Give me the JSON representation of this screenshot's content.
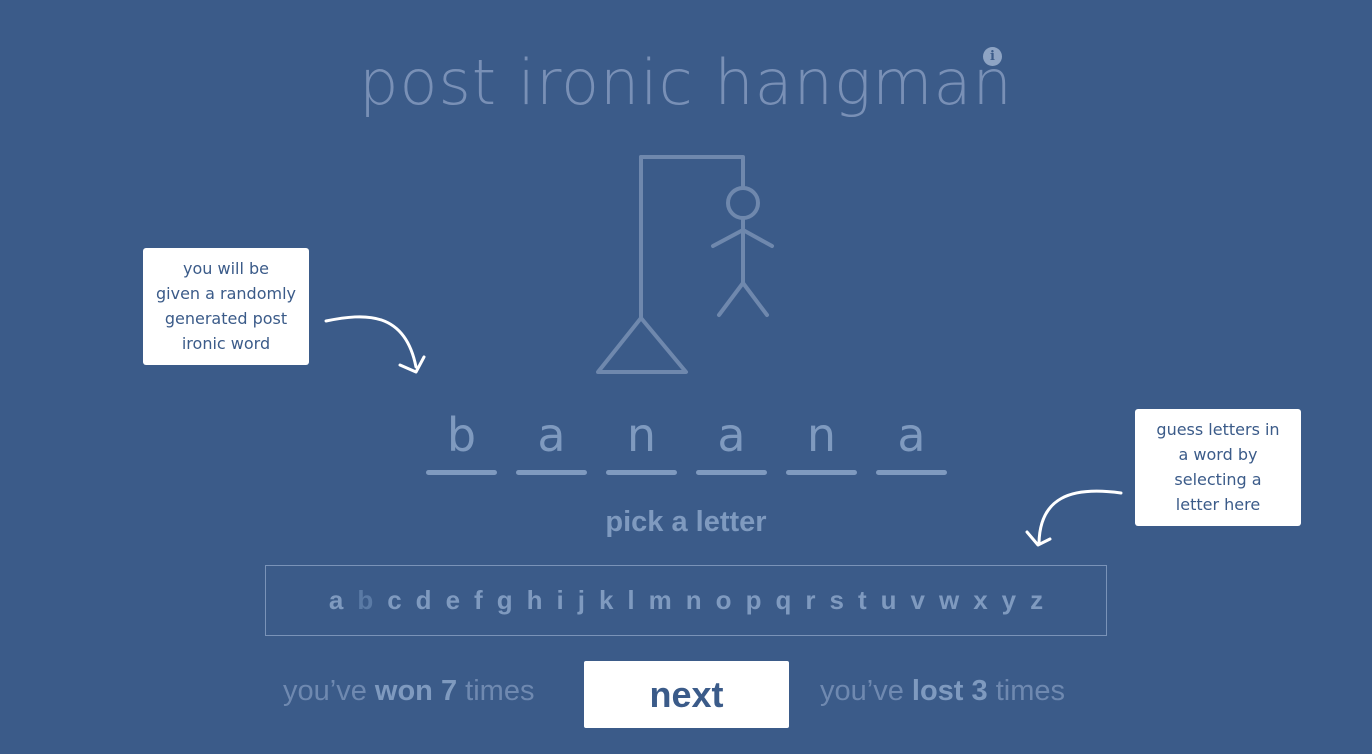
{
  "title": "post ironic hangman",
  "info_icon": "info-icon",
  "tooltips": {
    "left": [
      "you will be",
      "given a randomly",
      "generated post",
      "ironic word"
    ],
    "right": [
      "guess letters in",
      "a word by",
      "selecting a",
      "letter here"
    ]
  },
  "word": [
    "b",
    "a",
    "n",
    "a",
    "n",
    "a"
  ],
  "pick_label": "pick a letter",
  "alphabet": [
    "a",
    "b",
    "c",
    "d",
    "e",
    "f",
    "g",
    "h",
    "i",
    "j",
    "k",
    "l",
    "m",
    "n",
    "o",
    "p",
    "q",
    "r",
    "s",
    "t",
    "u",
    "v",
    "w",
    "x",
    "y",
    "z"
  ],
  "used_letters": [
    "b"
  ],
  "score": {
    "won_prefix": "you’ve",
    "won_label": "won",
    "won_count": "7",
    "won_suffix": "times",
    "lost_prefix": "you’ve",
    "lost_label": "lost",
    "lost_count": "3",
    "lost_suffix": "times"
  },
  "next_label": "next",
  "colors": {
    "background": "#3b5b89",
    "muted_text": "#7f9abf",
    "used_letter": "#5a7aa5",
    "card": "#ffffff"
  }
}
